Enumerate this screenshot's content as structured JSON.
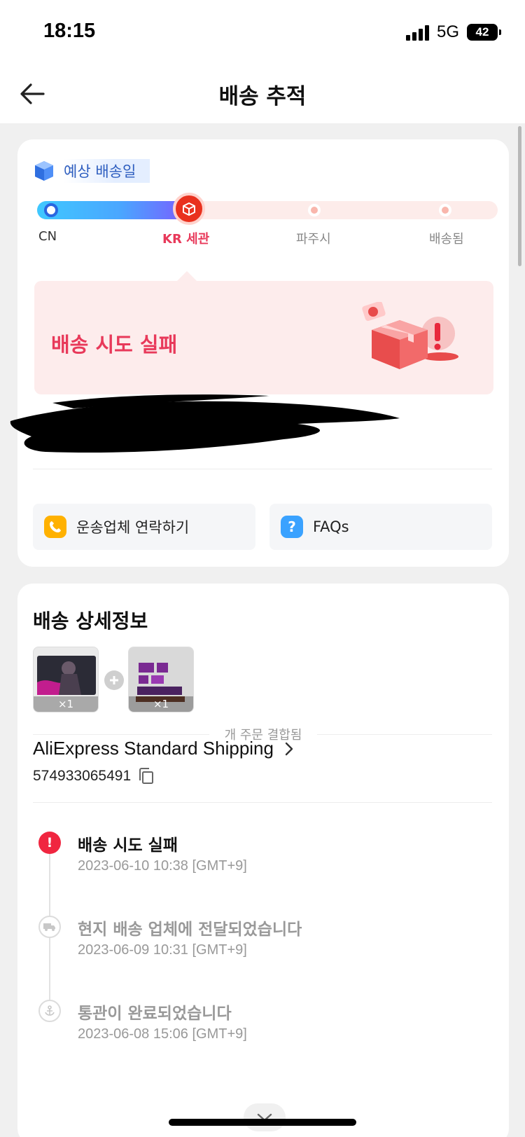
{
  "status_bar": {
    "time": "18:15",
    "network": "5G",
    "battery": "42"
  },
  "header": {
    "title": "배송 추적"
  },
  "tracking": {
    "estimate_label": "예상 배송일",
    "progress_fraction": 0.33,
    "stages": [
      {
        "label": "CN",
        "state": "done"
      },
      {
        "label": "KR 세관",
        "state": "current"
      },
      {
        "label": "파주시",
        "state": "pending"
      },
      {
        "label": "배송됨",
        "state": "pending"
      }
    ],
    "status_text": "배송 시도 실패",
    "actions": [
      {
        "label": "운송업체 연락하기",
        "icon": "phone-icon",
        "color": "#ffb100"
      },
      {
        "label": "FAQs",
        "icon": "question-icon",
        "color": "#3aa2ff"
      }
    ]
  },
  "details": {
    "title": "배송 상세정보",
    "items": [
      {
        "qty": "×1"
      },
      {
        "qty": "×1"
      }
    ],
    "combined_label": "개 주문 결합됨",
    "carrier": "AliExpress Standard Shipping",
    "tracking_number": "574933065491",
    "events": [
      {
        "title": "배송 시도 실패",
        "date": "2023-06-10 10:38 [GMT+9]",
        "icon": "alert-icon"
      },
      {
        "title": "현지 배송 업체에 전달되었습니다",
        "date": "2023-06-09 10:31 [GMT+9]",
        "icon": "truck-icon"
      },
      {
        "title": "통관이 완료되었습니다",
        "date": "2023-06-08 15:06 [GMT+9]",
        "icon": "anchor-icon"
      }
    ]
  },
  "colors": {
    "accent": "#e8395a",
    "brand_red": "#e9311e",
    "link_blue": "#2d5dbf"
  }
}
